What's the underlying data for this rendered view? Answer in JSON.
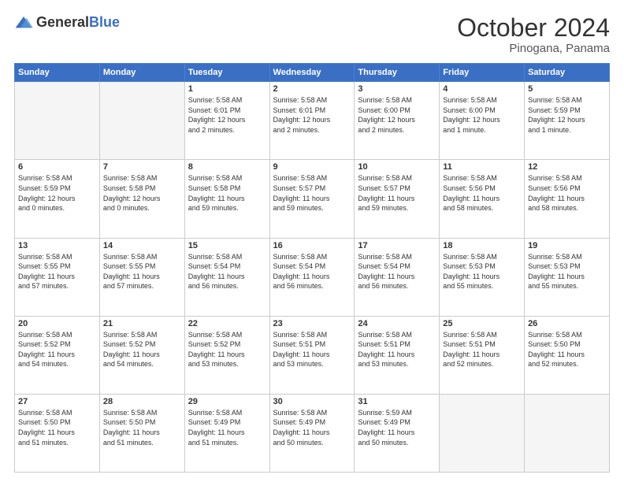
{
  "header": {
    "logo_general": "General",
    "logo_blue": "Blue",
    "month": "October 2024",
    "location": "Pinogana, Panama"
  },
  "days_of_week": [
    "Sunday",
    "Monday",
    "Tuesday",
    "Wednesday",
    "Thursday",
    "Friday",
    "Saturday"
  ],
  "weeks": [
    [
      {
        "day": "",
        "empty": true
      },
      {
        "day": "",
        "empty": true
      },
      {
        "day": "1",
        "info": "Sunrise: 5:58 AM\nSunset: 6:01 PM\nDaylight: 12 hours\nand 2 minutes."
      },
      {
        "day": "2",
        "info": "Sunrise: 5:58 AM\nSunset: 6:01 PM\nDaylight: 12 hours\nand 2 minutes."
      },
      {
        "day": "3",
        "info": "Sunrise: 5:58 AM\nSunset: 6:00 PM\nDaylight: 12 hours\nand 2 minutes."
      },
      {
        "day": "4",
        "info": "Sunrise: 5:58 AM\nSunset: 6:00 PM\nDaylight: 12 hours\nand 1 minute."
      },
      {
        "day": "5",
        "info": "Sunrise: 5:58 AM\nSunset: 5:59 PM\nDaylight: 12 hours\nand 1 minute."
      }
    ],
    [
      {
        "day": "6",
        "info": "Sunrise: 5:58 AM\nSunset: 5:59 PM\nDaylight: 12 hours\nand 0 minutes."
      },
      {
        "day": "7",
        "info": "Sunrise: 5:58 AM\nSunset: 5:58 PM\nDaylight: 12 hours\nand 0 minutes."
      },
      {
        "day": "8",
        "info": "Sunrise: 5:58 AM\nSunset: 5:58 PM\nDaylight: 11 hours\nand 59 minutes."
      },
      {
        "day": "9",
        "info": "Sunrise: 5:58 AM\nSunset: 5:57 PM\nDaylight: 11 hours\nand 59 minutes."
      },
      {
        "day": "10",
        "info": "Sunrise: 5:58 AM\nSunset: 5:57 PM\nDaylight: 11 hours\nand 59 minutes."
      },
      {
        "day": "11",
        "info": "Sunrise: 5:58 AM\nSunset: 5:56 PM\nDaylight: 11 hours\nand 58 minutes."
      },
      {
        "day": "12",
        "info": "Sunrise: 5:58 AM\nSunset: 5:56 PM\nDaylight: 11 hours\nand 58 minutes."
      }
    ],
    [
      {
        "day": "13",
        "info": "Sunrise: 5:58 AM\nSunset: 5:55 PM\nDaylight: 11 hours\nand 57 minutes."
      },
      {
        "day": "14",
        "info": "Sunrise: 5:58 AM\nSunset: 5:55 PM\nDaylight: 11 hours\nand 57 minutes."
      },
      {
        "day": "15",
        "info": "Sunrise: 5:58 AM\nSunset: 5:54 PM\nDaylight: 11 hours\nand 56 minutes."
      },
      {
        "day": "16",
        "info": "Sunrise: 5:58 AM\nSunset: 5:54 PM\nDaylight: 11 hours\nand 56 minutes."
      },
      {
        "day": "17",
        "info": "Sunrise: 5:58 AM\nSunset: 5:54 PM\nDaylight: 11 hours\nand 56 minutes."
      },
      {
        "day": "18",
        "info": "Sunrise: 5:58 AM\nSunset: 5:53 PM\nDaylight: 11 hours\nand 55 minutes."
      },
      {
        "day": "19",
        "info": "Sunrise: 5:58 AM\nSunset: 5:53 PM\nDaylight: 11 hours\nand 55 minutes."
      }
    ],
    [
      {
        "day": "20",
        "info": "Sunrise: 5:58 AM\nSunset: 5:52 PM\nDaylight: 11 hours\nand 54 minutes."
      },
      {
        "day": "21",
        "info": "Sunrise: 5:58 AM\nSunset: 5:52 PM\nDaylight: 11 hours\nand 54 minutes."
      },
      {
        "day": "22",
        "info": "Sunrise: 5:58 AM\nSunset: 5:52 PM\nDaylight: 11 hours\nand 53 minutes."
      },
      {
        "day": "23",
        "info": "Sunrise: 5:58 AM\nSunset: 5:51 PM\nDaylight: 11 hours\nand 53 minutes."
      },
      {
        "day": "24",
        "info": "Sunrise: 5:58 AM\nSunset: 5:51 PM\nDaylight: 11 hours\nand 53 minutes."
      },
      {
        "day": "25",
        "info": "Sunrise: 5:58 AM\nSunset: 5:51 PM\nDaylight: 11 hours\nand 52 minutes."
      },
      {
        "day": "26",
        "info": "Sunrise: 5:58 AM\nSunset: 5:50 PM\nDaylight: 11 hours\nand 52 minutes."
      }
    ],
    [
      {
        "day": "27",
        "info": "Sunrise: 5:58 AM\nSunset: 5:50 PM\nDaylight: 11 hours\nand 51 minutes."
      },
      {
        "day": "28",
        "info": "Sunrise: 5:58 AM\nSunset: 5:50 PM\nDaylight: 11 hours\nand 51 minutes."
      },
      {
        "day": "29",
        "info": "Sunrise: 5:58 AM\nSunset: 5:49 PM\nDaylight: 11 hours\nand 51 minutes."
      },
      {
        "day": "30",
        "info": "Sunrise: 5:58 AM\nSunset: 5:49 PM\nDaylight: 11 hours\nand 50 minutes."
      },
      {
        "day": "31",
        "info": "Sunrise: 5:59 AM\nSunset: 5:49 PM\nDaylight: 11 hours\nand 50 minutes."
      },
      {
        "day": "",
        "empty": true
      },
      {
        "day": "",
        "empty": true
      }
    ]
  ]
}
